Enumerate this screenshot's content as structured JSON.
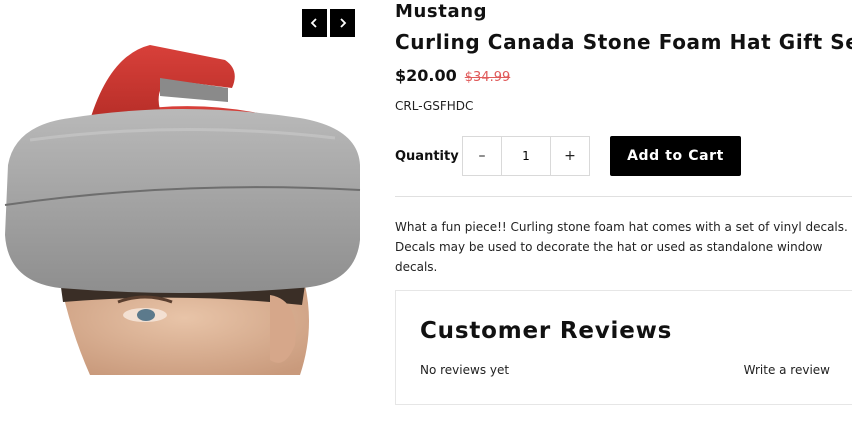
{
  "product": {
    "vendor": "Mustang",
    "title": "Curling Canada Stone Foam Hat Gift Set",
    "price": "$20.00",
    "compare_price": "$34.99",
    "sku": "CRL-GSFHDC",
    "description": "What a fun piece!! Curling stone foam hat comes with a set of vinyl decals. Decals may be used to decorate the hat or used as standalone window decals."
  },
  "gallery": {
    "prev_icon": "chevron-left-icon",
    "next_icon": "chevron-right-icon"
  },
  "purchase": {
    "quantity_label": "Quantity",
    "quantity_value": "1",
    "minus_label": "–",
    "plus_label": "+",
    "add_to_cart_label": "Add to Cart"
  },
  "reviews": {
    "title": "Customer Reviews",
    "empty_text": "No reviews yet",
    "write_link": "Write a review"
  },
  "colors": {
    "accent": "#000000",
    "sale_price": "#e05a5a",
    "stone_red": "#c8302c",
    "stone_gray": "#a6a6a6"
  }
}
